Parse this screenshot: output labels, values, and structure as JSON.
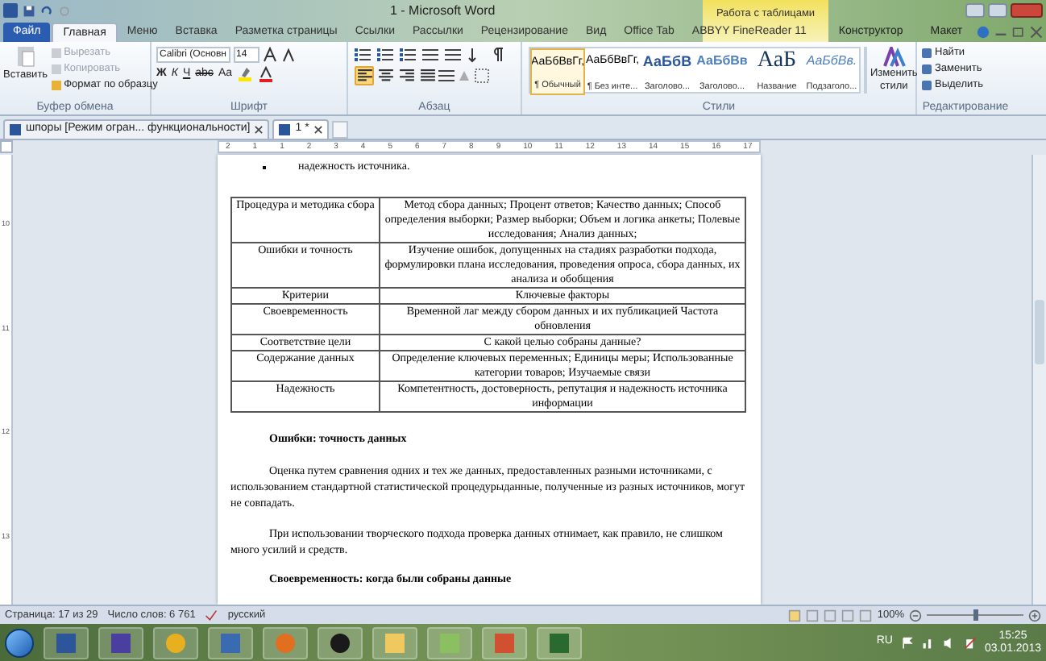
{
  "window": {
    "title": "1 - Microsoft Word",
    "context_group": "Работа с таблицами"
  },
  "tabs": [
    {
      "label": "Файл",
      "kind": "file",
      "selected": false
    },
    {
      "label": "Главная",
      "kind": "normal",
      "selected": true
    },
    {
      "label": "Меню",
      "kind": "normal",
      "selected": false
    },
    {
      "label": "Вставка",
      "kind": "normal",
      "selected": false
    },
    {
      "label": "Разметка страницы",
      "kind": "normal",
      "selected": false
    },
    {
      "label": "Ссылки",
      "kind": "normal",
      "selected": false
    },
    {
      "label": "Рассылки",
      "kind": "normal",
      "selected": false
    },
    {
      "label": "Рецензирование",
      "kind": "normal",
      "selected": false
    },
    {
      "label": "Вид",
      "kind": "normal",
      "selected": false
    },
    {
      "label": "Office Tab",
      "kind": "normal",
      "selected": false
    },
    {
      "label": "ABBYY FineReader 11",
      "kind": "normal",
      "selected": false
    },
    {
      "label": "Конструктор",
      "kind": "context",
      "selected": false
    },
    {
      "label": "Макет",
      "kind": "context",
      "selected": false
    }
  ],
  "clipboard": {
    "label": "Буфер обмена",
    "paste": "Вставить",
    "items": [
      {
        "label": "Вырезать",
        "disabled": true
      },
      {
        "label": "Копировать",
        "disabled": true
      },
      {
        "label": "Формат по образцу",
        "disabled": false
      }
    ]
  },
  "font": {
    "label": "Шрифт",
    "name": "Calibri (Основн",
    "size": "14",
    "buttons": [
      "Ж",
      "К",
      "Ч",
      "abc",
      "Aa"
    ]
  },
  "paragraph": {
    "label": "Абзац",
    "align": [
      {
        "selected": true
      },
      {
        "selected": false
      },
      {
        "selected": false
      },
      {
        "selected": false
      }
    ]
  },
  "styles": {
    "label": "Стили",
    "change": "Изменить стили",
    "items": [
      {
        "preview": "АаБбВвГг,",
        "name": "¶ Обычный",
        "kind": "normal",
        "selected": true
      },
      {
        "preview": "АаБбВвГг,",
        "name": "¶ Без инте...",
        "kind": "normal",
        "selected": false
      },
      {
        "preview": "АаБбВ",
        "name": "Заголово...",
        "kind": "heading1",
        "selected": false
      },
      {
        "preview": "АаБбВв",
        "name": "Заголово...",
        "kind": "heading2",
        "selected": false
      },
      {
        "preview": "АаБ",
        "name": "Название",
        "kind": "title",
        "selected": false
      },
      {
        "preview": "АаБбВв.",
        "name": "Подзаголо...",
        "kind": "subtitle",
        "selected": false
      }
    ]
  },
  "editing": {
    "label": "Редактирование",
    "items": [
      "Найти",
      "Заменить",
      "Выделить"
    ]
  },
  "doc_tabs": [
    {
      "label": "шпоры [Режим огран... функциональности]",
      "selected": false
    },
    {
      "label": "1 *",
      "selected": true
    }
  ],
  "ruler": {
    "marks": [
      "2",
      "1",
      "1",
      "2",
      "3",
      "4",
      "5",
      "6",
      "7",
      "8",
      "9",
      "10",
      "11",
      "12",
      "13",
      "14",
      "15",
      "16",
      "17"
    ]
  },
  "vertical_ruler": {
    "marks": [
      "10",
      "11",
      "12",
      "13"
    ]
  },
  "document": {
    "bullet": "надежность источника.",
    "table": [
      [
        "Процедура и методика сбора",
        "Метод сбора данных; Процент ответов; Качество данных; Способ определения выборки; Размер выборки; Объем и логика анкеты; Полевые исследования; Анализ данных;"
      ],
      [
        "Ошибки и точность",
        "Изучение ошибок, допущенных на стадиях разработки подхода, формулировки плана исследования, проведения опроса, сбора данных, их анализа и обобщения"
      ],
      [
        "Критерии",
        "Ключевые факторы"
      ],
      [
        "Своевременность",
        "Временной лаг между сбором данных и их публикацией Частота обновления"
      ],
      [
        "Соответствие цели",
        "С какой целью собраны данные?"
      ],
      [
        "Содержание данных",
        "Определение ключевых переменных; Единицы меры; Использованные категории товаров; Изучаемые связи"
      ],
      [
        "Надежность",
        "Компетентность, достоверность, репутация и надежность источника информации"
      ]
    ],
    "blocks": [
      {
        "kind": "heading",
        "text": "Ошибки: точность данных"
      },
      {
        "kind": "paragraph",
        "text": "Оценка путем сравнения одних и тех же данных, предоставленных разными источниками, с использованием стандартной статистической процедурыданные, полученные из разных источников, могут не совпадать."
      },
      {
        "kind": "paragraph",
        "text": "При использовании творческого подхода проверка данных отнимает, как правило, не слишком много усилий и средств."
      },
      {
        "kind": "heading",
        "text": "Своевременность: когда были собраны данные"
      }
    ]
  },
  "status_bar": {
    "page": "Страница: 17 из 29",
    "words": "Число слов: 6 761",
    "language": "русский",
    "zoom": "100%",
    "zoom_slider": {
      "level": 0.5
    }
  },
  "taskbar": {
    "language": "RU",
    "time": "15:25",
    "date": "03.01.2013"
  }
}
